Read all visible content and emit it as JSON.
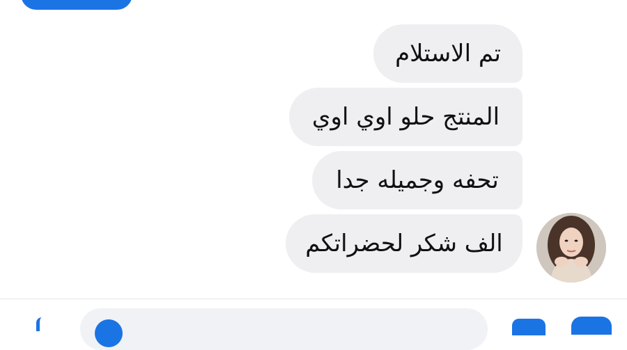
{
  "messages": [
    {
      "text": "تم الاستلام"
    },
    {
      "text": "المنتج حلو اوي اوي"
    },
    {
      "text": "تحفه وجميله جدا"
    },
    {
      "text": "الف شكر لحضراتكم"
    }
  ],
  "colors": {
    "accent": "#1b74e4",
    "bubble": "#efeff1",
    "text": "#111111",
    "divider": "#e4e6eb"
  },
  "icons": {
    "avatar": "avatar-photo",
    "composer_left": "plus-icon",
    "composer_emoji": "smile-icon",
    "camera": "camera-icon",
    "like": "like-icon"
  }
}
